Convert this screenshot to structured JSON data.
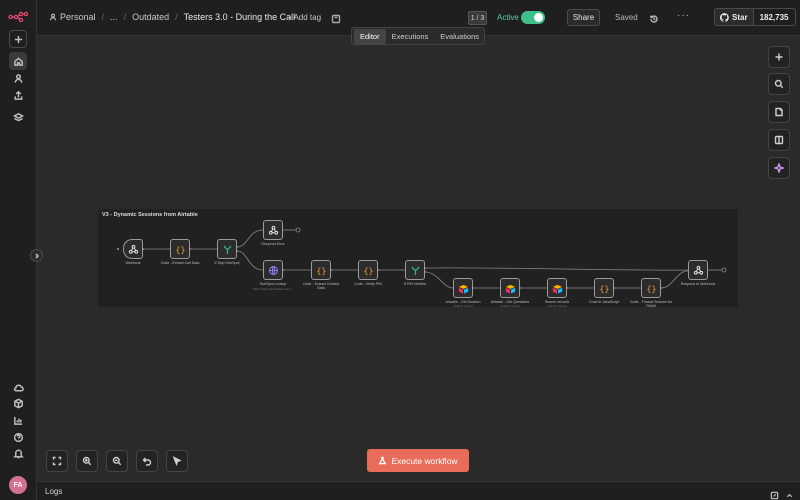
{
  "header": {
    "breadcrumb": [
      "Personal",
      "...",
      "Outdated"
    ],
    "workflow_title": "Testers 3.0 - During the Call",
    "add_tag": "+ Add tag",
    "version_badge": "1 / 3",
    "active_label": "Active",
    "active": true,
    "share_label": "Share",
    "saved_label": "Saved",
    "github": {
      "star_label": "Star",
      "star_count": "182,735"
    }
  },
  "tabs": [
    "Editor",
    "Executions",
    "Evaluations"
  ],
  "selected_tab": "Editor",
  "sidebar": {
    "top_icons": [
      "plus-icon",
      "home-icon",
      "user-icon",
      "share-icon",
      "layers-icon"
    ],
    "bottom_icons": [
      "cloud-icon",
      "package-icon",
      "chart-icon",
      "help-icon",
      "bell-icon"
    ],
    "avatar_initials": "FA"
  },
  "canvas": {
    "right_toolbar": [
      "plus-icon",
      "search-icon",
      "sticky-note-icon",
      "panel-icon",
      "sparkle-icon"
    ],
    "workflow": {
      "title": "V3 - Dynamic Sessions from Airtable",
      "nodes": [
        {
          "id": "webhook",
          "label": "Webhook",
          "sub": "",
          "icon": "webhook"
        },
        {
          "id": "code_extract_call",
          "label": "Code - Extract Call Data",
          "sub": "",
          "icon": "code"
        },
        {
          "id": "if_skip_hubspot",
          "label": "If Skip HubSpot",
          "sub": "",
          "icon": "if"
        },
        {
          "id": "respond_error",
          "label": "Respond Error",
          "sub": "",
          "icon": "webhook"
        },
        {
          "id": "hubspot_lookup",
          "label": "HubSpot Lookup",
          "sub": "GET: https://api.hubapi.com/...",
          "icon": "http"
        },
        {
          "id": "code_extract_contact",
          "label": "Code - Extract Contact Data",
          "sub": "",
          "icon": "code"
        },
        {
          "id": "code_verify_pin",
          "label": "Code - Verify PIN",
          "sub": "",
          "icon": "code"
        },
        {
          "id": "if_pin_verified",
          "label": "If PIN Verified",
          "sub": "",
          "icon": "if"
        },
        {
          "id": "airtable_get_session",
          "label": "Airtable - Get Session",
          "sub": "search: record",
          "icon": "airtable"
        },
        {
          "id": "airtable_get_questions",
          "label": "Airtable - Get Questions",
          "sub": "search: record",
          "icon": "airtable"
        },
        {
          "id": "search_records",
          "label": "Search records",
          "sub": "search: record",
          "icon": "airtable"
        },
        {
          "id": "code_js",
          "label": "Code in JavaScript",
          "sub": "",
          "icon": "code"
        },
        {
          "id": "code_format_session",
          "label": "Code - Format Session for Retell",
          "sub": "",
          "icon": "code"
        },
        {
          "id": "respond_webhook",
          "label": "Respond to Webhook",
          "sub": "",
          "icon": "webhook"
        }
      ]
    }
  },
  "bottom_controls": [
    "fit-view-icon",
    "zoom-in-icon",
    "zoom-out-icon",
    "undo-icon",
    "pointer-icon"
  ],
  "execute_label": "Execute workflow",
  "logs_label": "Logs",
  "colors": {
    "accent": "#e96c5a",
    "active_green": "#3fbf8a",
    "code_orange": "#f0a030",
    "if_green": "#35b38a",
    "http_purple": "#8a7ef0"
  }
}
